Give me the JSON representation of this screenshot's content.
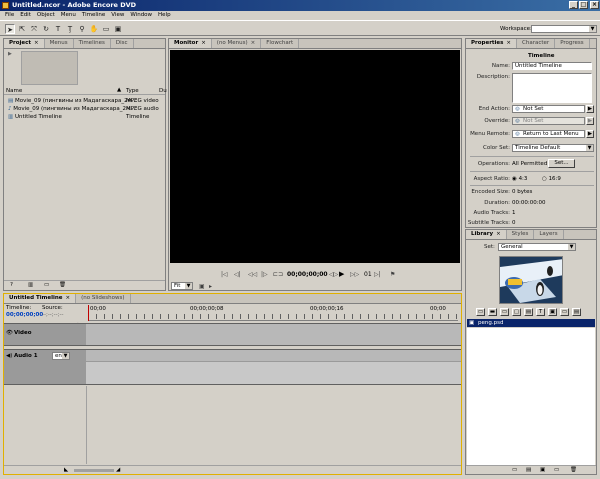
{
  "window": {
    "title": "Untitled.ncor - Adobe Encore DVD",
    "min": "_",
    "max": "□",
    "close": "×"
  },
  "menu": [
    "File",
    "Edit",
    "Object",
    "Menu",
    "Timeline",
    "View",
    "Window",
    "Help"
  ],
  "toolbar": {
    "workspace_label": "Workspace:",
    "workspace_value": ""
  },
  "project": {
    "tabs": [
      {
        "label": "Project"
      },
      {
        "label": "Menus"
      },
      {
        "label": "Timelines"
      },
      {
        "label": "Disc"
      }
    ],
    "columns": [
      "Name",
      "Type",
      "Du"
    ],
    "rows": [
      {
        "name": "Movie_09 (пингвины из Мадагаскара_2м...",
        "type": "MPEG video"
      },
      {
        "name": "Movie_09 (пингвины из Мадагаскара_2м...",
        "type": "MPEG audio"
      },
      {
        "name": "Untitled Timeline",
        "type": "Timeline"
      }
    ]
  },
  "monitor": {
    "tabs": [
      {
        "label": "Monitor"
      },
      {
        "label": "(no Menus)"
      },
      {
        "label": "Flowchart"
      }
    ],
    "timecode": "00;00;00;00",
    "chapter": "01",
    "fit": "Fit"
  },
  "properties": {
    "tabs": [
      {
        "label": "Properties"
      },
      {
        "label": "Character"
      },
      {
        "label": "Progress"
      }
    ],
    "heading": "Timeline",
    "name_label": "Name:",
    "name_value": "Untitled Timeline",
    "description_label": "Description:",
    "end_action_label": "End Action:",
    "end_action_value": "Not Set",
    "override_label": "Override:",
    "override_value": "Not Set",
    "menu_remote_label": "Menu Remote:",
    "menu_remote_value": "Return to Last Menu",
    "color_set_label": "Color Set:",
    "color_set_value": "Timeline Default",
    "operations_label": "Operations:",
    "operations_value": "All Permitted",
    "set_button": "Set...",
    "aspect_label": "Aspect Ratio:",
    "aspect_4_3": "4:3",
    "aspect_16_9": "16:9",
    "encoded_label": "Encoded Size:",
    "encoded_value": "0 bytes",
    "duration_label": "Duration:",
    "duration_value": "00:00:00:00",
    "audio_label": "Audio Tracks:",
    "audio_value": "1",
    "subtitle_label": "Subtitle Tracks:",
    "subtitle_value": "0"
  },
  "library": {
    "tabs": [
      {
        "label": "Library"
      },
      {
        "label": "Styles"
      },
      {
        "label": "Layers"
      }
    ],
    "set_label": "Set:",
    "set_value": "General",
    "item": "peng.psd"
  },
  "timeline": {
    "tabs": [
      {
        "label": "Untitled Timeline"
      },
      {
        "label": "(no Slideshows)"
      }
    ],
    "timeline_label": "Timeline:",
    "source_label": "Source:",
    "timeline_tc": "00;00;00;00",
    "source_tc": "--;--;--;--",
    "ruler": [
      "00;00",
      "00;00;00;08",
      "00;00;00;16",
      "00;00"
    ],
    "video_track": "Video",
    "audio_track": "Audio 1",
    "audio_lang": "en"
  },
  "colors": {
    "accent": "#0a246a",
    "timecode_blue": "#0040c0",
    "selection": "#0a246a"
  }
}
